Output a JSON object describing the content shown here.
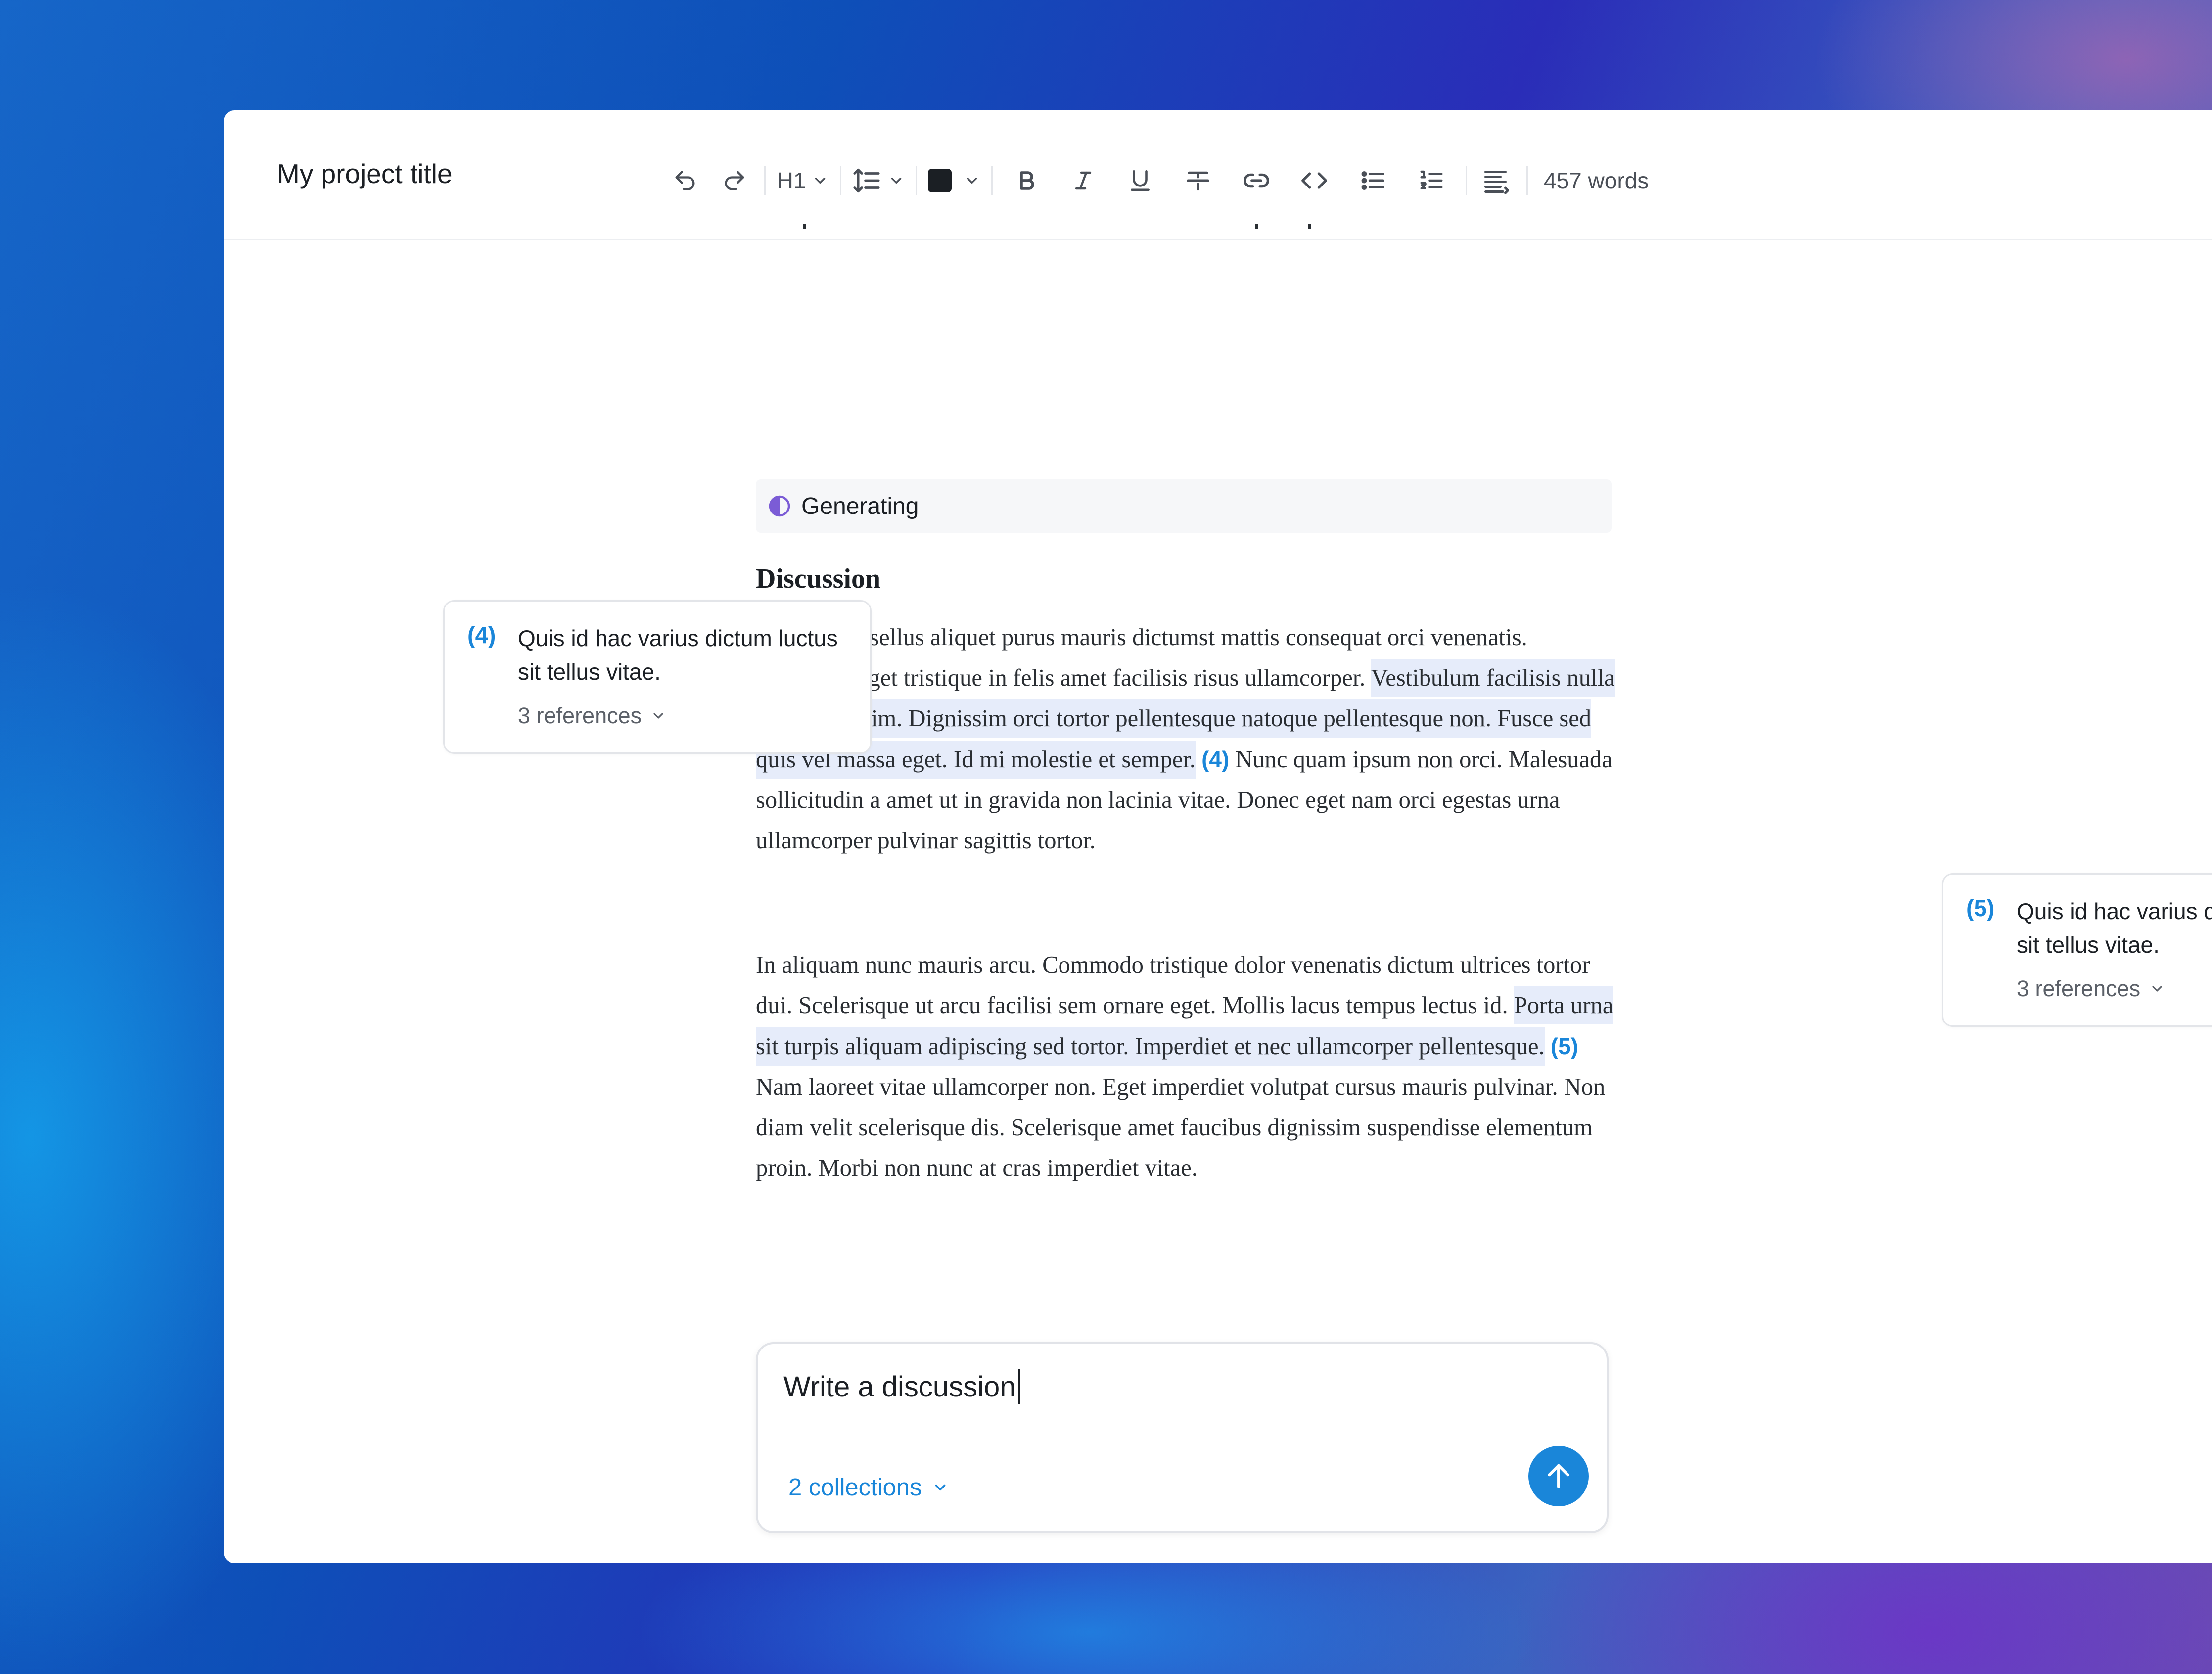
{
  "window": {
    "project_title": "My project title"
  },
  "toolbar": {
    "heading_level": "H1",
    "text_color": "#1b1f24",
    "word_count": "457 words",
    "icons": [
      "undo-icon",
      "redo-icon",
      "chevron-down-icon",
      "line-spacing-icon",
      "color-swatch-icon",
      "bold-icon",
      "italic-icon",
      "underline-icon",
      "strikethrough-icon",
      "link-icon",
      "code-icon",
      "bullet-list-icon",
      "numbered-list-icon",
      "align-icon"
    ]
  },
  "document": {
    "status_label": "Generating",
    "heading": "Discussion",
    "paragraph1": {
      "before": "Egestas phasellus aliquet purus mauris dictumst mattis consequat orci venenatis. Maecenas eget tristique in felis amet facilisis risus ullamcorper. ",
      "highlight": "Vestibulum facilisis nulla interdum enim. Dignissim orci tortor pellentesque natoque pellentesque non. Fusce sed quis vel massa eget. Id mi molestie et semper.",
      "citation": "(4)",
      "after": " Nunc quam ipsum non orci. Malesuada sollicitudin a amet ut in gravida non lacinia vitae. Donec eget nam orci egestas urna ullamcorper pulvinar sagittis tortor."
    },
    "paragraph2": {
      "before": "In aliquam nunc mauris arcu. Commodo tristique dolor venenatis dictum ultrices tortor dui. Scelerisque ut arcu facilisi sem ornare eget. Mollis lacus tempus lectus id. ",
      "highlight": "Porta urna sit turpis aliquam adipiscing sed tortor. Imperdiet et nec ullamcorper pellentesque.",
      "citation": "(5)",
      "after": " Nam laoreet vitae ullamcorper non. Eget imperdiet volutpat cursus mauris pulvinar. Non diam velit scelerisque dis. Scelerisque amet faucibus dignissim suspendisse elementum proin. Morbi non nunc at cras imperdiet vitae."
    }
  },
  "citations": [
    {
      "number": "(4)",
      "text": "Quis id hac varius dictum luctus sit tellus vitae.",
      "references": "3 references"
    },
    {
      "number": "(5)",
      "text": "Quis id hac varius dictum luctus sit tellus vitae.",
      "references": "3 references"
    }
  ],
  "prompt": {
    "value": "Write a discussion",
    "collections": "2 collections"
  },
  "colors": {
    "accent": "#1a86d9",
    "highlight": "#e6ecfa",
    "generating_icon": "#7b5cd6"
  }
}
